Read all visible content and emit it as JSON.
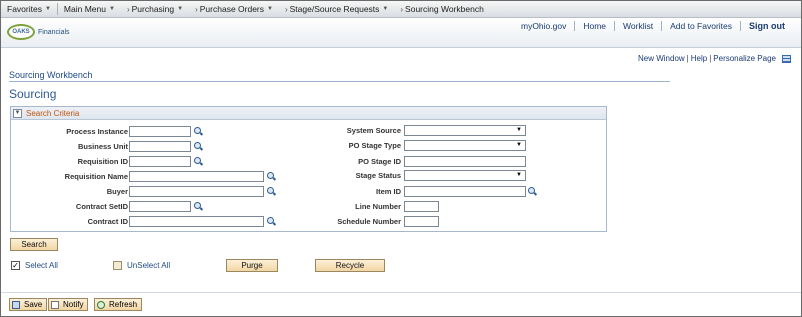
{
  "topnav": {
    "favorites": "Favorites",
    "main_menu": "Main Menu",
    "crumbs": [
      "Purchasing",
      "Purchase Orders",
      "Stage/Source Requests",
      "Sourcing Workbench"
    ]
  },
  "banner": {
    "logo_text": "OAKS",
    "logo_sub": "Financials",
    "links": [
      "myOhio.gov",
      "Home",
      "Worklist",
      "Add to Favorites",
      "Sign out"
    ]
  },
  "page_links": {
    "new_window": "New Window",
    "help": "Help",
    "personalize": "Personalize Page"
  },
  "page": {
    "breadcrumb_title": "Sourcing Workbench",
    "title": "Sourcing"
  },
  "search": {
    "group_title": "Search Criteria",
    "left_fields": [
      {
        "label": "Process Instance",
        "value": ""
      },
      {
        "label": "Business Unit",
        "value": ""
      },
      {
        "label": "Requisition ID",
        "value": ""
      },
      {
        "label": "Requisition Name",
        "value": ""
      },
      {
        "label": "Buyer",
        "value": ""
      },
      {
        "label": "Contract SetID",
        "value": ""
      },
      {
        "label": "Contract ID",
        "value": ""
      }
    ],
    "right_fields": [
      {
        "label": "System Source",
        "value": ""
      },
      {
        "label": "PO Stage Type",
        "value": ""
      },
      {
        "label": "PO Stage ID",
        "value": ""
      },
      {
        "label": "Stage Status",
        "value": ""
      },
      {
        "label": "Item ID",
        "value": ""
      },
      {
        "label": "Line Number",
        "value": ""
      },
      {
        "label": "Schedule Number",
        "value": ""
      }
    ]
  },
  "actions": {
    "search": "Search",
    "select_all": "Select All",
    "unselect_all": "UnSelect All",
    "purge": "Purge",
    "recycle": "Recycle"
  },
  "toolbar": {
    "save": "Save",
    "notify": "Notify",
    "refresh": "Refresh"
  }
}
